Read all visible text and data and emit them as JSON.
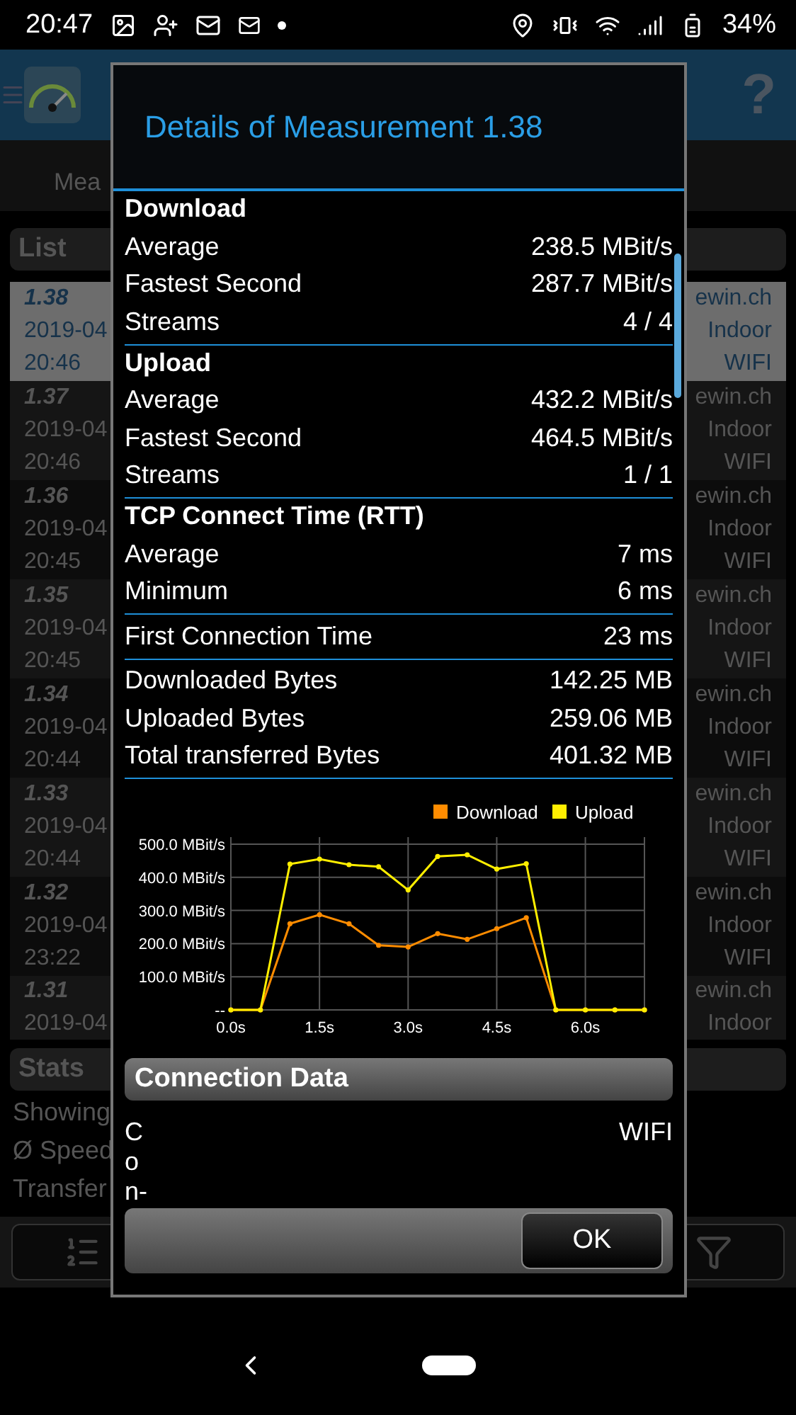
{
  "status_bar": {
    "time": "20:47",
    "battery": "34%"
  },
  "app_header": {
    "help": "?"
  },
  "tabs": [
    {
      "label": "Mea"
    }
  ],
  "list": {
    "title": "List",
    "rows": [
      {
        "id": "1.38",
        "date": "2019-04",
        "time": "20:46",
        "server": "ewin.ch",
        "location": "Indoor",
        "network": "WIFI",
        "selected": true
      },
      {
        "id": "1.37",
        "date": "2019-04",
        "time": "20:46",
        "server": "ewin.ch",
        "location": "Indoor",
        "network": "WIFI",
        "selected": false
      },
      {
        "id": "1.36",
        "date": "2019-04",
        "time": "20:45",
        "server": "ewin.ch",
        "location": "Indoor",
        "network": "WIFI",
        "selected": false
      },
      {
        "id": "1.35",
        "date": "2019-04",
        "time": "20:45",
        "server": "ewin.ch",
        "location": "Indoor",
        "network": "WIFI",
        "selected": false
      },
      {
        "id": "1.34",
        "date": "2019-04",
        "time": "20:44",
        "server": "ewin.ch",
        "location": "Indoor",
        "network": "WIFI",
        "selected": false
      },
      {
        "id": "1.33",
        "date": "2019-04",
        "time": "20:44",
        "server": "ewin.ch",
        "location": "Indoor",
        "network": "WIFI",
        "selected": false
      },
      {
        "id": "1.32",
        "date": "2019-04",
        "time": "23:22",
        "server": "ewin.ch",
        "location": "Indoor",
        "network": "WIFI",
        "selected": false
      },
      {
        "id": "1.31",
        "date": "2019-04",
        "server": "ewin.ch",
        "location": "Indoor",
        "selected": false
      }
    ]
  },
  "stats": {
    "title": "Stats",
    "lines": [
      "Showing",
      "Ø Speed",
      "Transfer"
    ]
  },
  "dialog": {
    "title": "Details of Measurement 1.38",
    "sections": [
      {
        "heading": "Download",
        "rows": [
          {
            "label": "Average",
            "value": "238.5 MBit/s"
          },
          {
            "label": "Fastest Second",
            "value": "287.7 MBit/s"
          },
          {
            "label": "Streams",
            "value": "4 / 4"
          }
        ]
      },
      {
        "heading": "Upload",
        "rows": [
          {
            "label": "Average",
            "value": "432.2 MBit/s"
          },
          {
            "label": "Fastest Second",
            "value": "464.5 MBit/s"
          },
          {
            "label": "Streams",
            "value": "1 / 1"
          }
        ]
      },
      {
        "heading": "TCP Connect Time (RTT)",
        "rows": [
          {
            "label": "Average",
            "value": "7 ms"
          },
          {
            "label": "Minimum",
            "value": "6 ms"
          }
        ]
      },
      {
        "rows": [
          {
            "label": "First Connection Time",
            "value": "23 ms"
          }
        ]
      },
      {
        "rows": [
          {
            "label": "Downloaded Bytes",
            "value": "142.25 MB"
          },
          {
            "label": "Uploaded Bytes",
            "value": "259.06 MB"
          },
          {
            "label": "Total transferred Bytes",
            "value": "401.32 MB"
          }
        ]
      }
    ],
    "chart_data": {
      "type": "line",
      "x": [
        0,
        0.5,
        1,
        1.5,
        2,
        2.5,
        3,
        3.5,
        4,
        4.5,
        5,
        5.5,
        6,
        6.5,
        7
      ],
      "series": [
        {
          "name": "Download",
          "color": "#ff8c00",
          "marker": "circle",
          "values": [
            0,
            0,
            260,
            287,
            260,
            195,
            190,
            230,
            213,
            245,
            278,
            0,
            0,
            0,
            0
          ]
        },
        {
          "name": "Upload",
          "color": "#ffee00",
          "marker": "circle",
          "values": [
            0,
            0,
            440,
            455,
            438,
            432,
            362,
            463,
            468,
            425,
            441,
            0,
            0,
            0,
            0
          ]
        }
      ],
      "xlim": [
        0,
        7
      ],
      "ylim": [
        0,
        500
      ],
      "grid": true,
      "legend": true,
      "xticks": [
        {
          "value": 0,
          "label": "0.0s"
        },
        {
          "value": 1.5,
          "label": "1.5s"
        },
        {
          "value": 3,
          "label": "3.0s"
        },
        {
          "value": 4.5,
          "label": "4.5s"
        },
        {
          "value": 6,
          "label": "6.0s"
        }
      ],
      "yticks": [
        {
          "value": 0,
          "label": "--"
        },
        {
          "value": 100,
          "label": "100.0 MBit/s"
        },
        {
          "value": 200,
          "label": "200.0 MBit/s"
        },
        {
          "value": 300,
          "label": "300.0 MBit/s"
        },
        {
          "value": 400,
          "label": "400.0 MBit/s"
        },
        {
          "value": 500,
          "label": "500.0 MBit/s"
        }
      ]
    },
    "connection": {
      "title": "Connection Data",
      "label": "Con-",
      "value": "WIFI"
    },
    "button": "OK"
  }
}
